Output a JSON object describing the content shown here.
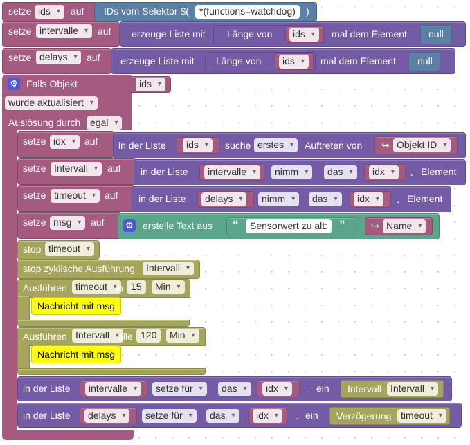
{
  "colors": {
    "variables": "#a55b80",
    "lists": "#745ba5",
    "events": "#a55b80",
    "timers": "#a5a55b",
    "text": "#5ba58c",
    "selector": "#5b80a5",
    "comment": "#ffff00"
  },
  "b1": {
    "set": "setze",
    "var": "ids",
    "to": "auf",
    "selector_label": "IDs vom Selektor $(",
    "selector_value": "*(functions=watchdog)",
    "close": ")"
  },
  "b2": {
    "set": "setze",
    "var": "intervalle",
    "to": "auf",
    "create": "erzeuge Liste mit",
    "length_of": "Länge von",
    "list": "ids",
    "times": "mal dem Element",
    "value": "null"
  },
  "b3": {
    "set": "setze",
    "var": "delays",
    "to": "auf",
    "create": "erzeuge Liste mit",
    "length_of": "Länge von",
    "list": "ids",
    "times": "mal dem Element",
    "value": "null"
  },
  "trigger": {
    "label": "Falls Objekt",
    "object": "ids",
    "event": "wurde aktualisiert",
    "trigger_by": "Auslösung durch",
    "trigger_value": "egal"
  },
  "s1": {
    "set": "setze",
    "var": "idx",
    "to": "auf",
    "in_list": "in der Liste",
    "list": "ids",
    "find": "suche",
    "which": "erstes",
    "occurrence": "Auftreten von",
    "obj": "Objekt ID"
  },
  "s2": {
    "set": "setze",
    "var": "Intervall",
    "to": "auf",
    "in_list": "in der Liste",
    "list": "intervalle",
    "op": "nimm",
    "which": "das",
    "idx": "idx",
    "element": "Element"
  },
  "s3": {
    "set": "setze",
    "var": "timeout",
    "to": "auf",
    "in_list": "in der Liste",
    "list": "delays",
    "op": "nimm",
    "which": "das",
    "idx": "idx",
    "element": "Element"
  },
  "s4": {
    "set": "setze",
    "var": "msg",
    "to": "auf",
    "create_text": "erstelle Text aus",
    "text": "Sensorwert zu alt:",
    "name": "Name"
  },
  "s5": {
    "label": "stop",
    "var": "timeout"
  },
  "s6": {
    "label": "stop zyklische Ausführung",
    "var": "Intervall"
  },
  "s7": {
    "label": "Ausführen",
    "var": "timeout",
    "in": "in",
    "value": "15",
    "unit": "Min",
    "note": "Nachricht mit msg"
  },
  "s8": {
    "label": "Ausführen",
    "var": "Intervall",
    "every": "alle",
    "value": "120",
    "unit": "Min",
    "note": "Nachricht mit msg"
  },
  "s9": {
    "in_list": "in der Liste",
    "list": "intervalle",
    "op": "setze für",
    "which": "das",
    "idx": "idx",
    "as": "ein",
    "value_label": "Intervall",
    "value_var": "Intervall"
  },
  "s10": {
    "in_list": "in der Liste",
    "list": "delays",
    "op": "setze für",
    "which": "das",
    "idx": "idx",
    "as": "ein",
    "value_label": "Verzögerung",
    "value_var": "timeout"
  }
}
